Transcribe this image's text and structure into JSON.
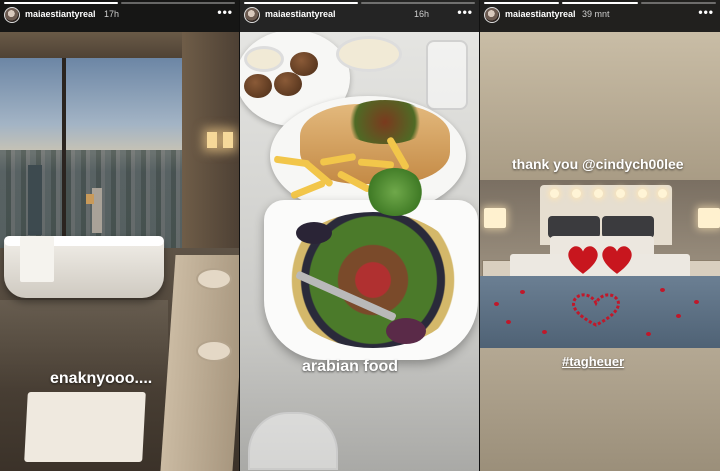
{
  "stories": [
    {
      "username": "maiaestiantyreal",
      "time": "17h",
      "caption": "enaknyooo....",
      "progress": [
        1,
        0
      ]
    },
    {
      "username": "maiaestiantyreal",
      "time": "16h",
      "caption": "arabian food",
      "progress": [
        1,
        0
      ]
    },
    {
      "username": "maiaestiantyreal",
      "time": "39 mnt",
      "caption": "thank you @cindych00lee",
      "caption2": "#tagheuer",
      "progress": [
        1,
        1,
        0
      ]
    }
  ],
  "icons": {
    "more": "more-options-icon",
    "avatar": "profile-avatar"
  },
  "colors": {
    "header_bg": "#141414",
    "progress_done": "#ffffff",
    "progress_pending": "#8a8a8a",
    "heart_red": "#c0182a"
  }
}
